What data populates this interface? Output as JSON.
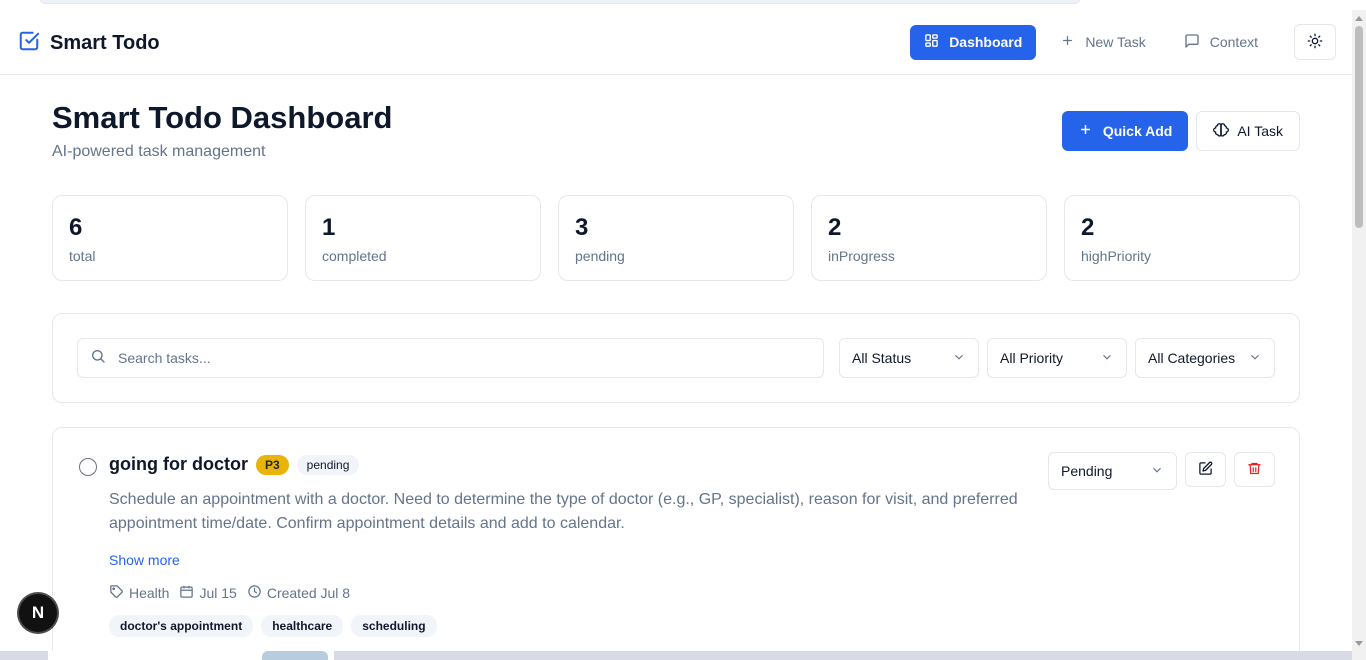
{
  "app": {
    "title": "Smart Todo",
    "icon": "check-square-icon"
  },
  "nav": {
    "items": [
      {
        "label": "Dashboard",
        "icon": "layout-grid-icon",
        "active": true
      },
      {
        "label": "New Task",
        "icon": "plus-icon",
        "active": false
      },
      {
        "label": "Context",
        "icon": "message-square-icon",
        "active": false
      }
    ],
    "theme_icon": "sun-icon"
  },
  "page": {
    "title": "Smart Todo Dashboard",
    "subtitle": "AI-powered task management",
    "quick_add_label": "Quick Add",
    "ai_task_label": "AI Task"
  },
  "stats": [
    {
      "value": "6",
      "label": "total"
    },
    {
      "value": "1",
      "label": "completed"
    },
    {
      "value": "3",
      "label": "pending"
    },
    {
      "value": "2",
      "label": "inProgress"
    },
    {
      "value": "2",
      "label": "highPriority"
    }
  ],
  "filters": {
    "search_placeholder": "Search tasks...",
    "status": "All Status",
    "priority": "All Priority",
    "category": "All Categories"
  },
  "task": {
    "title": "going for doctor",
    "priority": "P3",
    "status_badge": "pending",
    "description": "Schedule an appointment with a doctor. Need to determine the type of doctor (e.g., GP, specialist), reason for visit, and preferred appointment time/date. Confirm appointment details and add to calendar.",
    "show_more": "Show more",
    "category": "Health",
    "due": "Jul 15",
    "created": "Created Jul 8",
    "tags": [
      "doctor's appointment",
      "healthcare",
      "scheduling"
    ],
    "status_select": "Pending"
  },
  "floating_badge": "N",
  "colors": {
    "primary": "#2563eb",
    "priority_badge": "#eab308",
    "delete": "#dc2626",
    "muted": "#64748b"
  }
}
